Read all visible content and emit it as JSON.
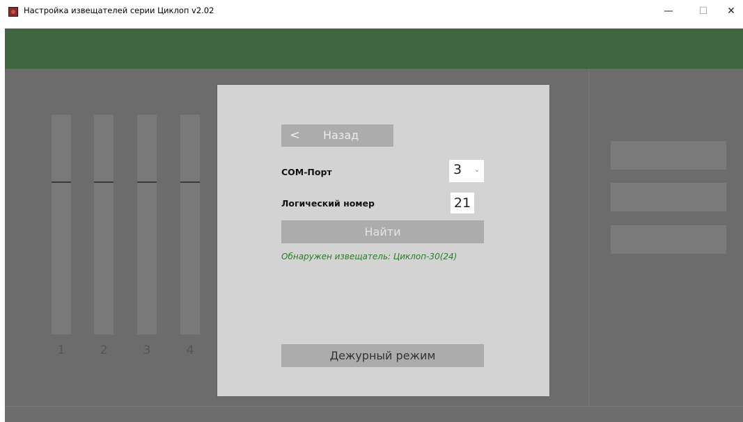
{
  "window": {
    "title": "Настройка извещателей серии Циклоп v2.02",
    "min_glyph": "—",
    "max_glyph": "☐",
    "close_glyph": "✕"
  },
  "sliders": [
    {
      "label": "1"
    },
    {
      "label": "2"
    },
    {
      "label": "3"
    },
    {
      "label": "4"
    }
  ],
  "dialog": {
    "back_chevron": "<",
    "back_label": "Назад",
    "com_port_label": "COM-Порт",
    "com_port_value": "3",
    "com_port_chevron": "⌄",
    "logical_number_label": "Логический номер",
    "logical_number_value": "21",
    "find_label": "Найти",
    "status_text": "Обнаружен извещатель: Циклоп-30(24)",
    "duty_mode_label": "Дежурный режим"
  },
  "colors": {
    "header_green": "#3f663f",
    "status_green": "#2c7a2c"
  }
}
